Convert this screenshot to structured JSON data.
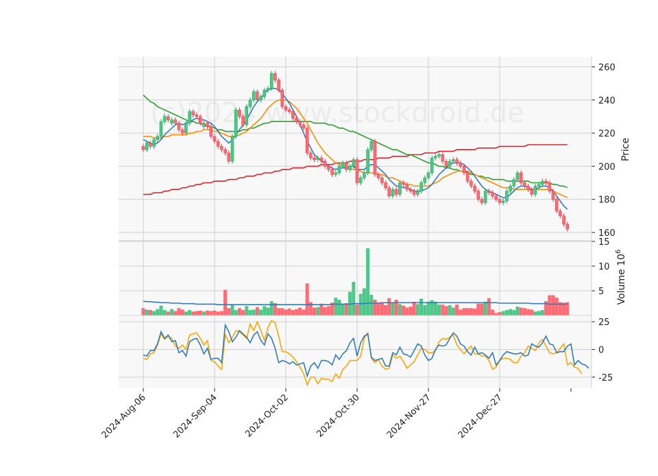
{
  "watermark": "(c)2024 www.stockdroid.de",
  "colors": {
    "up": "#26a65b",
    "up_fill": "#4fc78a",
    "down": "#e8404a",
    "down_fill": "#ff6b75",
    "ma_short": "#2f7bbf",
    "ma_mid": "#ff8c00",
    "ma_long": "#2ca02c",
    "ma_200": "#d62728",
    "osc_a": "#2f7bbf",
    "osc_b": "#ffa500",
    "vol_avg": "#2f7bbf",
    "panel_bg": "#f8f8f8",
    "grid": "#d0d0d0"
  },
  "chart_data": [
    {
      "type": "candlestick",
      "panel": "price",
      "ylabel": "Price",
      "ylim": [
        155,
        266
      ],
      "yticks": [
        160,
        180,
        200,
        220,
        240,
        260
      ],
      "x_tick_labels": [
        "2024-Aug-06",
        "2024-Sep-04",
        "2024-Oct-02",
        "2024-Oct-30",
        "2024-Nov-27",
        "2024-Dec-27"
      ],
      "x_tick_index": [
        0,
        20,
        40,
        60,
        80,
        100
      ],
      "grid": true,
      "close": [
        210,
        214,
        212,
        216,
        218,
        227,
        230,
        228,
        228,
        226,
        222,
        220,
        226,
        233,
        231,
        230,
        226,
        226,
        224,
        218,
        215,
        212,
        210,
        208,
        203,
        218,
        234,
        230,
        225,
        236,
        240,
        245,
        240,
        242,
        246,
        247,
        256,
        252,
        246,
        236,
        234,
        233,
        229,
        227,
        225,
        223,
        208,
        205,
        204,
        205,
        203,
        200,
        198,
        195,
        196,
        200,
        202,
        198,
        200,
        204,
        190,
        193,
        196,
        210,
        215,
        195,
        193,
        190,
        187,
        182,
        186,
        183,
        190,
        189,
        186,
        185,
        183,
        185,
        190,
        193,
        196,
        205,
        206,
        207,
        203,
        200,
        203,
        204,
        202,
        200,
        196,
        191,
        188,
        185,
        180,
        178,
        185,
        184,
        182,
        180,
        178,
        179,
        185,
        188,
        192,
        196,
        190,
        188,
        186,
        183,
        188,
        189,
        191,
        190,
        185,
        180,
        173,
        170,
        165,
        162
      ],
      "candle_dir": [
        -1,
        1,
        -1,
        1,
        1,
        1,
        1,
        -1,
        1,
        -1,
        -1,
        -1,
        1,
        1,
        -1,
        -1,
        -1,
        1,
        -1,
        -1,
        -1,
        -1,
        -1,
        -1,
        -1,
        1,
        1,
        -1,
        -1,
        1,
        1,
        1,
        -1,
        1,
        1,
        1,
        1,
        -1,
        -1,
        -1,
        -1,
        -1,
        -1,
        -1,
        -1,
        -1,
        -1,
        -1,
        -1,
        1,
        -1,
        -1,
        -1,
        -1,
        1,
        1,
        1,
        -1,
        1,
        1,
        -1,
        1,
        1,
        1,
        1,
        -1,
        -1,
        -1,
        -1,
        -1,
        1,
        -1,
        1,
        -1,
        -1,
        -1,
        -1,
        1,
        1,
        1,
        1,
        1,
        1,
        1,
        -1,
        -1,
        1,
        1,
        -1,
        -1,
        -1,
        -1,
        -1,
        -1,
        -1,
        -1,
        1,
        -1,
        -1,
        -1,
        -1,
        1,
        1,
        1,
        1,
        1,
        -1,
        -1,
        -1,
        -1,
        1,
        1,
        1,
        -1,
        -1,
        -1,
        -1,
        -1,
        -1,
        -1
      ],
      "ma_short": [
        216,
        215,
        214,
        213,
        214,
        216,
        219,
        221,
        223,
        225,
        226,
        225,
        226,
        227,
        228,
        229,
        228,
        228,
        227,
        226,
        224,
        221,
        218,
        216,
        214,
        216,
        219,
        222,
        225,
        228,
        232,
        236,
        239,
        241,
        244,
        246,
        247,
        247,
        246,
        244,
        241,
        238,
        234,
        230,
        225,
        220,
        215,
        211,
        207,
        205,
        203,
        202,
        200,
        199,
        198,
        199,
        199,
        199,
        200,
        200,
        198,
        198,
        198,
        200,
        201,
        201,
        199,
        197,
        195,
        192,
        190,
        188,
        188,
        187,
        187,
        186,
        185,
        185,
        185,
        186,
        187,
        189,
        192,
        195,
        197,
        199,
        201,
        202,
        202,
        202,
        201,
        199,
        197,
        194,
        191,
        188,
        186,
        185,
        184,
        183,
        182,
        181,
        181,
        183,
        185,
        187,
        188,
        188,
        187,
        186,
        186,
        187,
        188,
        188,
        187,
        185,
        182,
        179,
        176,
        174
      ],
      "ma_mid": [
        218,
        218,
        218,
        217,
        217,
        217,
        218,
        218,
        219,
        219,
        219,
        219,
        219,
        220,
        220,
        221,
        221,
        222,
        222,
        222,
        221,
        221,
        220,
        219,
        218,
        218,
        218,
        219,
        220,
        221,
        223,
        225,
        227,
        229,
        232,
        235,
        237,
        239,
        240,
        240,
        240,
        239,
        237,
        235,
        232,
        229,
        226,
        222,
        218,
        214,
        211,
        208,
        206,
        204,
        202,
        201,
        200,
        199,
        198,
        198,
        198,
        197,
        196,
        196,
        196,
        196,
        195,
        195,
        194,
        193,
        193,
        192,
        191,
        190,
        189,
        189,
        188,
        188,
        188,
        188,
        188,
        189,
        190,
        191,
        193,
        194,
        195,
        196,
        197,
        197,
        197,
        197,
        196,
        195,
        194,
        193,
        192,
        191,
        190,
        189,
        188,
        187,
        187,
        187,
        186,
        186,
        186,
        186,
        186,
        186,
        186,
        186,
        186,
        186,
        186,
        185,
        184,
        183,
        182,
        181
      ],
      "ma_long": [
        243,
        241,
        239,
        238,
        236,
        235,
        234,
        233,
        232,
        231,
        230,
        229,
        228,
        227,
        227,
        226,
        226,
        225,
        224,
        224,
        223,
        222,
        222,
        221,
        221,
        221,
        221,
        221,
        222,
        222,
        223,
        223,
        224,
        225,
        226,
        226,
        227,
        227,
        227,
        227,
        227,
        227,
        227,
        227,
        227,
        227,
        227,
        227,
        226,
        226,
        226,
        226,
        225,
        225,
        224,
        223,
        223,
        222,
        221,
        221,
        220,
        219,
        218,
        217,
        216,
        215,
        214,
        213,
        212,
        211,
        210,
        210,
        209,
        208,
        207,
        207,
        206,
        205,
        204,
        203,
        202,
        202,
        201,
        200,
        200,
        199,
        199,
        198,
        198,
        197,
        197,
        196,
        195,
        195,
        194,
        194,
        193,
        193,
        192,
        192,
        192,
        192,
        191,
        191,
        191,
        191,
        191,
        191,
        191,
        190,
        190,
        190,
        190,
        190,
        190,
        189,
        189,
        188,
        188,
        187
      ],
      "ma_200": [
        183,
        183,
        183,
        184,
        184,
        184,
        185,
        185,
        186,
        186,
        186,
        187,
        187,
        188,
        188,
        189,
        189,
        190,
        190,
        190,
        191,
        191,
        191,
        191,
        192,
        192,
        192,
        193,
        193,
        194,
        194,
        194,
        195,
        195,
        196,
        196,
        196,
        197,
        197,
        198,
        198,
        198,
        199,
        199,
        199,
        199,
        200,
        200,
        200,
        200,
        201,
        201,
        201,
        201,
        202,
        202,
        202,
        202,
        203,
        203,
        203,
        203,
        204,
        204,
        204,
        204,
        205,
        205,
        205,
        205,
        206,
        206,
        206,
        206,
        206,
        207,
        207,
        207,
        207,
        208,
        208,
        208,
        208,
        209,
        209,
        209,
        209,
        209,
        210,
        210,
        210,
        210,
        210,
        210,
        211,
        211,
        211,
        211,
        211,
        211,
        212,
        212,
        212,
        212,
        212,
        212,
        212,
        212,
        213,
        213,
        213,
        213,
        213,
        213,
        213,
        213,
        213,
        213,
        213,
        213
      ]
    },
    {
      "type": "bar",
      "panel": "volume",
      "ylabel": "Volume  10^6",
      "ylim": [
        0,
        15
      ],
      "yticks": [
        5,
        10,
        15
      ],
      "grid": true,
      "values": [
        1.5,
        1.2,
        1.1,
        0.9,
        1.3,
        2.0,
        1.1,
        0.8,
        1.3,
        0.9,
        1.5,
        1.2,
        0.8,
        1.1,
        0.8,
        0.9,
        1.0,
        0.8,
        1.0,
        0.9,
        1.0,
        0.8,
        0.9,
        5.2,
        1.5,
        2.3,
        1.1,
        1.5,
        1.1,
        1.9,
        1.1,
        1.2,
        1.7,
        1.2,
        1.9,
        1.6,
        2.9,
        2.5,
        1.5,
        1.5,
        1.2,
        1.4,
        1.1,
        1.3,
        1.6,
        1.2,
        6.5,
        2.7,
        1.6,
        1.7,
        2.4,
        1.7,
        1.9,
        2.6,
        3.6,
        3.2,
        2.3,
        2.5,
        4.8,
        6.8,
        2.2,
        4.4,
        5.5,
        13.6,
        4.2,
        3.2,
        2.6,
        2.7,
        2.1,
        3.5,
        2.7,
        3.2,
        2.3,
        2.0,
        1.6,
        1.8,
        2.8,
        2.3,
        3.4,
        2.1,
        2.8,
        3.1,
        2.8,
        2.2,
        2.2,
        1.9,
        2.1,
        1.6,
        2.2,
        1.2,
        1.5,
        1.5,
        1.5,
        1.4,
        2.4,
        2.4,
        2.8,
        3.5,
        1.2,
        0.5,
        0.7,
        0.9,
        1.1,
        1.3,
        1.1,
        1.8,
        1.6,
        1.5,
        1.3,
        1.2,
        0.8,
        0.9,
        1.1,
        2.9,
        4.1,
        4.1,
        3.6,
        2.7,
        2.6,
        2.7
      ],
      "avg": [
        2.9,
        2.8,
        2.8,
        2.7,
        2.7,
        2.6,
        2.6,
        2.6,
        2.5,
        2.5,
        2.5,
        2.4,
        2.4,
        2.4,
        2.4,
        2.3,
        2.3,
        2.3,
        2.3,
        2.3,
        2.3,
        2.2,
        2.2,
        2.2,
        2.2,
        2.2,
        2.2,
        2.2,
        2.2,
        2.2,
        2.2,
        2.2,
        2.2,
        2.2,
        2.2,
        2.2,
        2.2,
        2.2,
        2.2,
        2.2,
        2.2,
        2.2,
        2.2,
        2.2,
        2.2,
        2.2,
        2.2,
        2.2,
        2.2,
        2.2,
        2.2,
        2.2,
        2.2,
        2.3,
        2.3,
        2.3,
        2.3,
        2.3,
        2.3,
        2.4,
        2.4,
        2.4,
        2.4,
        2.5,
        2.5,
        2.5,
        2.5,
        2.6,
        2.6,
        2.6,
        2.6,
        2.6,
        2.6,
        2.6,
        2.6,
        2.6,
        2.6,
        2.6,
        2.6,
        2.6,
        2.6,
        2.6,
        2.6,
        2.6,
        2.6,
        2.6,
        2.6,
        2.6,
        2.6,
        2.6,
        2.6,
        2.6,
        2.6,
        2.6,
        2.6,
        2.6,
        2.6,
        2.6,
        2.6,
        2.6,
        2.5,
        2.5,
        2.5,
        2.5,
        2.5,
        2.5,
        2.5,
        2.5,
        2.5,
        2.4,
        2.4,
        2.4,
        2.4,
        2.4,
        2.3,
        2.3,
        2.3,
        2.3,
        2.3,
        2.3
      ]
    },
    {
      "type": "line",
      "panel": "oscillator",
      "ylim": [
        -35,
        30
      ],
      "yticks": [
        -25,
        0,
        25
      ],
      "grid": true,
      "series": [
        {
          "values": [
            -5,
            -6,
            -1,
            -1,
            5,
            16,
            10,
            13,
            7,
            8,
            -3,
            -1,
            -6,
            7,
            9,
            10,
            4,
            -4,
            1,
            -9,
            -8,
            -8,
            -12,
            22,
            16,
            7,
            11,
            17,
            14,
            11,
            6,
            13,
            16,
            8,
            4,
            14,
            10,
            1,
            -12,
            -10,
            -11,
            -13,
            -11,
            -14,
            -13,
            -12,
            -24,
            -15,
            -12,
            -17,
            -10,
            -10,
            -11,
            -14,
            -5,
            -9,
            -4,
            -1,
            6,
            10,
            -6,
            6,
            12,
            14,
            -7,
            -10,
            -9,
            -8,
            -15,
            -15,
            -3,
            -5,
            2,
            -4,
            -5,
            -7,
            -1,
            5,
            3,
            -5,
            -10,
            -8,
            0,
            4,
            3,
            4,
            10,
            15,
            12,
            5,
            3,
            -2,
            -5,
            2,
            -4,
            -3,
            -5,
            -8,
            -3,
            -14,
            -10,
            -5,
            -2,
            -3,
            -4,
            -4,
            -3,
            -6,
            -5,
            5,
            3,
            2,
            6,
            12,
            5,
            4,
            -3,
            -2,
            -2,
            3,
            5,
            -14,
            -10,
            -13,
            -14,
            -17
          ]
        },
        {
          "values": [
            -8,
            -9,
            -4,
            -3,
            4,
            14,
            9,
            12,
            10,
            3,
            1,
            4,
            0,
            13,
            14,
            15,
            10,
            4,
            8,
            -10,
            -11,
            -15,
            -18,
            14,
            6,
            11,
            17,
            16,
            13,
            10,
            23,
            17,
            25,
            17,
            8,
            20,
            26,
            24,
            12,
            -2,
            -2,
            -4,
            -7,
            -11,
            -16,
            -22,
            -32,
            -25,
            -25,
            -31,
            -26,
            -27,
            -27,
            -29,
            -22,
            -26,
            -18,
            -15,
            -10,
            -10,
            -10,
            -6,
            10,
            15,
            -8,
            -12,
            -9,
            -15,
            -18,
            -17,
            -5,
            -8,
            -6,
            -11,
            -17,
            -14,
            -11,
            -5,
            1,
            0,
            -3,
            -3,
            -1,
            7,
            10,
            9,
            11,
            13,
            4,
            0,
            -4,
            0,
            3,
            -4,
            -4,
            -6,
            -6,
            -10,
            -18,
            -16,
            -10,
            -8,
            -8,
            -9,
            -12,
            -12,
            -6,
            -3,
            3,
            1,
            -1,
            6,
            9,
            3,
            -3,
            -4,
            -3,
            1,
            5,
            -14,
            -12,
            -16,
            -17,
            -22
          ]
        }
      ]
    }
  ]
}
